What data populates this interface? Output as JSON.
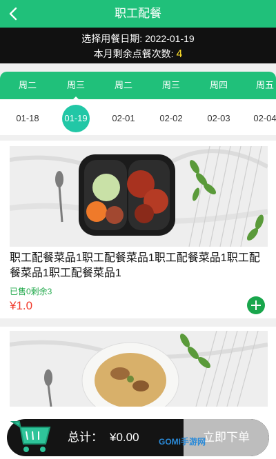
{
  "header": {
    "title": "职工配餐"
  },
  "info": {
    "date_line": "选择用餐日期: 2022-01-19",
    "remaining_label": "本月剩余点餐次数:",
    "remaining_count": "4"
  },
  "date_picker": {
    "days": [
      "周二",
      "周三",
      "周二",
      "周三",
      "周四",
      "周五"
    ],
    "dates": [
      "01-18",
      "01-19",
      "02-01",
      "02-02",
      "02-03",
      "02-04"
    ],
    "selected_index": 1
  },
  "items": [
    {
      "name": "职工配餐菜品1职工配餐菜品1职工配餐菜品1职工配餐菜品1职工配餐菜品1",
      "sold_remaining": "已售0剩余3",
      "price": "¥1.0"
    }
  ],
  "footer": {
    "total_label": "总计：",
    "total_amount": "¥0.00",
    "order_button": "立即下单"
  },
  "watermark": "GOMI手游网",
  "colors": {
    "brand_green": "#20c07a",
    "selected_circle": "#22c7a6",
    "price_red": "#f03b2c",
    "count_yellow": "#ffe02a"
  }
}
